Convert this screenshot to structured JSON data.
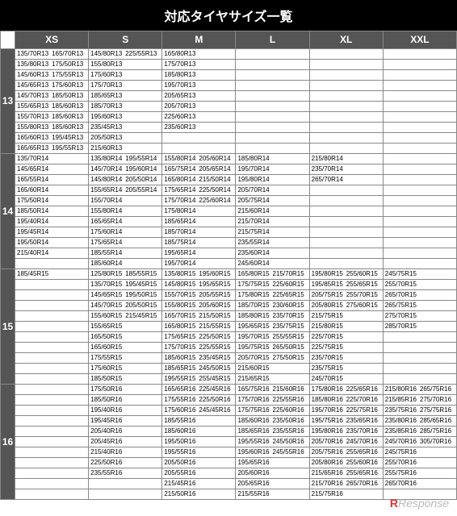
{
  "title": "対応タイヤサイズ一覧",
  "watermark": "Response",
  "sizes": [
    "XS",
    "S",
    "M",
    "L",
    "XL",
    "XXL"
  ],
  "groups": [
    {
      "inch": "13",
      "rows": [
        {
          "XS": [
            "135/70R13",
            "165/70R13"
          ],
          "S": [
            "145/80R13",
            "225/55R13"
          ],
          "M": [
            "165/80R13",
            ""
          ],
          "L": [
            "",
            ""
          ],
          "XL": [
            "",
            ""
          ],
          "XXL": [
            "",
            ""
          ]
        },
        {
          "XS": [
            "135/80R13",
            "175/50R13"
          ],
          "S": [
            "155/80R13",
            ""
          ],
          "M": [
            "175/70R13",
            ""
          ],
          "L": [
            "",
            ""
          ],
          "XL": [
            "",
            ""
          ],
          "XXL": [
            "",
            ""
          ]
        },
        {
          "XS": [
            "145/60R13",
            "175/55R13"
          ],
          "S": [
            "175/60R13",
            ""
          ],
          "M": [
            "185/80R13",
            ""
          ],
          "L": [
            "",
            ""
          ],
          "XL": [
            "",
            ""
          ],
          "XXL": [
            "",
            ""
          ]
        },
        {
          "XS": [
            "145/65R13",
            "175/60R13"
          ],
          "S": [
            "175/70R13",
            ""
          ],
          "M": [
            "195/70R13",
            ""
          ],
          "L": [
            "",
            ""
          ],
          "XL": [
            "",
            ""
          ],
          "XXL": [
            "",
            ""
          ]
        },
        {
          "XS": [
            "145/70R13",
            "185/50R13"
          ],
          "S": [
            "185/65R13",
            ""
          ],
          "M": [
            "205/65R13",
            ""
          ],
          "L": [
            "",
            ""
          ],
          "XL": [
            "",
            ""
          ],
          "XXL": [
            "",
            ""
          ]
        },
        {
          "XS": [
            "155/65R13",
            "185/60R13"
          ],
          "S": [
            "185/70R13",
            ""
          ],
          "M": [
            "205/70R13",
            ""
          ],
          "L": [
            "",
            ""
          ],
          "XL": [
            "",
            ""
          ],
          "XXL": [
            "",
            ""
          ]
        },
        {
          "XS": [
            "155/70R13",
            "185/60R13"
          ],
          "S": [
            "195/60R13",
            ""
          ],
          "M": [
            "225/60R13",
            ""
          ],
          "L": [
            "",
            ""
          ],
          "XL": [
            "",
            ""
          ],
          "XXL": [
            "",
            ""
          ]
        },
        {
          "XS": [
            "155/80R13",
            "185/60R13"
          ],
          "S": [
            "235/45R13",
            ""
          ],
          "M": [
            "235/60R13",
            ""
          ],
          "L": [
            "",
            ""
          ],
          "XL": [
            "",
            ""
          ],
          "XXL": [
            "",
            ""
          ]
        },
        {
          "XS": [
            "165/60R13",
            "195/45R13"
          ],
          "S": [
            "205/50R13",
            ""
          ],
          "M": [
            "",
            ""
          ],
          "L": [
            "",
            ""
          ],
          "XL": [
            "",
            ""
          ],
          "XXL": [
            "",
            ""
          ]
        },
        {
          "XS": [
            "165/65R13",
            "195/55R13"
          ],
          "S": [
            "215/60R13",
            ""
          ],
          "M": [
            "",
            ""
          ],
          "L": [
            "",
            ""
          ],
          "XL": [
            "",
            ""
          ],
          "XXL": [
            "",
            ""
          ]
        }
      ]
    },
    {
      "inch": "14",
      "rows": [
        {
          "XS": [
            "135/70R14",
            ""
          ],
          "S": [
            "135/80R14",
            "195/55R14"
          ],
          "M": [
            "155/80R14",
            "205/60R14"
          ],
          "L": [
            "185/80R14",
            ""
          ],
          "XL": [
            "215/80R14",
            ""
          ],
          "XXL": [
            "",
            ""
          ]
        },
        {
          "XS": [
            "145/65R14",
            ""
          ],
          "S": [
            "145/70R14",
            "195/60R14"
          ],
          "M": [
            "165/75R14",
            "205/65R14"
          ],
          "L": [
            "195/70R14",
            ""
          ],
          "XL": [
            "235/70R14",
            ""
          ],
          "XXL": [
            "",
            ""
          ]
        },
        {
          "XS": [
            "165/55R14",
            ""
          ],
          "S": [
            "145/80R14",
            "205/50R14"
          ],
          "M": [
            "165/80R14",
            "215/50R14"
          ],
          "L": [
            "195/80R14",
            ""
          ],
          "XL": [
            "265/70R14",
            ""
          ],
          "XXL": [
            "",
            ""
          ]
        },
        {
          "XS": [
            "165/60R14",
            ""
          ],
          "S": [
            "155/65R14",
            "205/55R14"
          ],
          "M": [
            "175/65R14",
            "225/50R14"
          ],
          "L": [
            "205/70R14",
            ""
          ],
          "XL": [
            "",
            ""
          ],
          "XXL": [
            "",
            ""
          ]
        },
        {
          "XS": [
            "175/50R14",
            ""
          ],
          "S": [
            "155/70R14",
            ""
          ],
          "M": [
            "175/70R14",
            "225/60R14"
          ],
          "L": [
            "205/75R14",
            ""
          ],
          "XL": [
            "",
            ""
          ],
          "XXL": [
            "",
            ""
          ]
        },
        {
          "XS": [
            "185/50R14",
            ""
          ],
          "S": [
            "155/80R14",
            ""
          ],
          "M": [
            "175/80R14",
            ""
          ],
          "L": [
            "215/60R14",
            ""
          ],
          "XXL": [
            "",
            ""
          ],
          "XL": [
            "",
            ""
          ]
        },
        {
          "XS": [
            "195/40R14",
            ""
          ],
          "S": [
            "165/65R14",
            ""
          ],
          "M": [
            "185/65R14",
            ""
          ],
          "L": [
            "215/70R14",
            ""
          ],
          "XL": [
            "",
            ""
          ],
          "XXL": [
            "",
            ""
          ]
        },
        {
          "XS": [
            "195/45R14",
            ""
          ],
          "S": [
            "175/60R14",
            ""
          ],
          "M": [
            "185/70R14",
            ""
          ],
          "L": [
            "215/75R14",
            ""
          ],
          "XL": [
            "",
            ""
          ],
          "XXL": [
            "",
            ""
          ]
        },
        {
          "XS": [
            "195/50R14",
            ""
          ],
          "S": [
            "175/65R14",
            ""
          ],
          "M": [
            "185/75R14",
            ""
          ],
          "L": [
            "235/55R14",
            ""
          ],
          "XL": [
            "",
            ""
          ],
          "XXL": [
            "",
            ""
          ]
        },
        {
          "XS": [
            "215/40R14",
            ""
          ],
          "S": [
            "185/55R14",
            ""
          ],
          "M": [
            "195/65R14",
            ""
          ],
          "L": [
            "235/60R14",
            ""
          ],
          "XL": [
            "",
            ""
          ],
          "XXL": [
            "",
            ""
          ]
        },
        {
          "XS": [
            "",
            ""
          ],
          "S": [
            "185/60R14",
            ""
          ],
          "M": [
            "195/70R14",
            ""
          ],
          "L": [
            "245/60R14",
            ""
          ],
          "XL": [
            "",
            ""
          ],
          "XXL": [
            "",
            ""
          ]
        }
      ]
    },
    {
      "inch": "15",
      "rows": [
        {
          "XS": [
            "185/45R15",
            ""
          ],
          "S": [
            "125/80R15",
            "185/55R15"
          ],
          "M": [
            "135/80R15",
            "195/60R15"
          ],
          "L": [
            "165/80R15",
            "215/70R15"
          ],
          "XL": [
            "195/80R15",
            "255/60R15"
          ],
          "XXL": [
            "245/75R15",
            ""
          ]
        },
        {
          "XS": [
            "",
            ""
          ],
          "S": [
            "135/70R15",
            "195/45R15"
          ],
          "M": [
            "145/80R15",
            "195/65R15"
          ],
          "L": [
            "175/75R15",
            "225/60R15"
          ],
          "XL": [
            "195/85R15",
            "255/65R15"
          ],
          "XXL": [
            "255/70R15",
            ""
          ]
        },
        {
          "XS": [
            "",
            ""
          ],
          "S": [
            "145/65R15",
            "195/50R15"
          ],
          "M": [
            "155/70R15",
            "205/55R15"
          ],
          "L": [
            "175/80R15",
            "225/65R15"
          ],
          "XL": [
            "205/75R15",
            "255/70R15"
          ],
          "XXL": [
            "265/70R15",
            ""
          ]
        },
        {
          "XS": [
            "",
            ""
          ],
          "S": [
            "145/70R15",
            "205/50R15"
          ],
          "M": [
            "155/80R15",
            "205/60R15"
          ],
          "L": [
            "185/70R15",
            "230/60R15"
          ],
          "XL": [
            "205/80R15",
            "275/60R15"
          ],
          "XXL": [
            "265/75R15",
            ""
          ]
        },
        {
          "XS": [
            "",
            ""
          ],
          "S": [
            "155/60R15",
            "215/45R15"
          ],
          "M": [
            "165/70R15",
            "215/50R15"
          ],
          "L": [
            "185/80R15",
            "235/70R15"
          ],
          "XL": [
            "215/75R15",
            ""
          ],
          "XXL": [
            "275/70R15",
            ""
          ]
        },
        {
          "XS": [
            "",
            ""
          ],
          "S": [
            "155/65R15",
            ""
          ],
          "M": [
            "165/80R15",
            "215/55R15"
          ],
          "L": [
            "195/65R15",
            "235/75R15"
          ],
          "XL": [
            "215/80R15",
            ""
          ],
          "XXL": [
            "285/70R15",
            ""
          ]
        },
        {
          "XS": [
            "",
            ""
          ],
          "S": [
            "165/50R15",
            ""
          ],
          "M": [
            "175/65R15",
            "225/50R15"
          ],
          "L": [
            "195/70R15",
            "255/55R15"
          ],
          "XL": [
            "225/70R15",
            ""
          ],
          "XXL": [
            "",
            ""
          ]
        },
        {
          "XS": [
            "",
            ""
          ],
          "S": [
            "165/60R15",
            ""
          ],
          "M": [
            "175/70R15",
            "225/55R15"
          ],
          "L": [
            "195/75R15",
            "265/50R15"
          ],
          "XL": [
            "225/75R15",
            ""
          ],
          "XXL": [
            "",
            ""
          ]
        },
        {
          "XS": [
            "",
            ""
          ],
          "S": [
            "175/55R15",
            ""
          ],
          "M": [
            "185/60R15",
            "235/45R15"
          ],
          "L": [
            "205/70R15",
            "275/50R15"
          ],
          "XL": [
            "235/70R15",
            ""
          ],
          "XXL": [
            "",
            ""
          ]
        },
        {
          "XS": [
            "",
            ""
          ],
          "S": [
            "175/60R15",
            ""
          ],
          "M": [
            "185/65R15",
            "245/50R15"
          ],
          "L": [
            "215/60R15",
            ""
          ],
          "XL": [
            "235/75R15",
            ""
          ],
          "XXL": [
            "",
            ""
          ]
        },
        {
          "XS": [
            "",
            ""
          ],
          "S": [
            "185/50R15",
            ""
          ],
          "M": [
            "195/55R15",
            "255/45R15"
          ],
          "L": [
            "215/65R15",
            ""
          ],
          "XL": [
            "245/70R15",
            ""
          ],
          "XXL": [
            "",
            ""
          ]
        }
      ]
    },
    {
      "inch": "16",
      "rows": [
        {
          "XS": [
            "",
            ""
          ],
          "S": [
            "175/50R16",
            ""
          ],
          "M": [
            "165/65R16",
            "225/45R16"
          ],
          "L": [
            "165/75R16",
            "215/60R16"
          ],
          "XL": [
            "175/80R16",
            "225/65R16"
          ],
          "XXL": [
            "215/80R16",
            "265/75R16"
          ]
        },
        {
          "XS": [
            "",
            ""
          ],
          "S": [
            "185/50R16",
            ""
          ],
          "M": [
            "175/55R16",
            "225/50R16"
          ],
          "L": [
            "175/70R16",
            "225/55R16"
          ],
          "XL": [
            "185/80R16",
            "225/70R16"
          ],
          "XXL": [
            "215/85R16",
            "275/70R16"
          ]
        },
        {
          "XS": [
            "",
            ""
          ],
          "S": [
            "195/40R16",
            ""
          ],
          "M": [
            "175/60R16",
            "245/45R16"
          ],
          "L": [
            "175/75R16",
            "225/60R16"
          ],
          "XL": [
            "195/70R16",
            "225/75R16"
          ],
          "XXL": [
            "235/75R16",
            "275/75R16"
          ]
        },
        {
          "XS": [
            "",
            ""
          ],
          "S": [
            "195/45R16",
            ""
          ],
          "M": [
            "185/55R16",
            ""
          ],
          "M2": "",
          "L": [
            "185/60R16",
            "235/50R16"
          ],
          "XL": [
            "195/75R16",
            "235/65R16"
          ],
          "XXL": [
            "235/80R16",
            "285/65R16"
          ]
        },
        {
          "XS": [
            "",
            ""
          ],
          "S": [
            "205/40R16",
            ""
          ],
          "M": [
            "185/60R16",
            ""
          ],
          "L": [
            "185/65R16",
            "235/55R16"
          ],
          "XL": [
            "195/80R16",
            "235/70R16"
          ],
          "XXL": [
            "235/85R16",
            "285/75R16"
          ]
        },
        {
          "XS": [
            "",
            ""
          ],
          "S": [
            "205/45R16",
            ""
          ],
          "M": [
            "195/50R16",
            ""
          ],
          "L": [
            "195/55R16",
            "245/50R16"
          ],
          "XL": [
            "205/70R16",
            "245/70R16"
          ],
          "XXL": [
            "245/70R16",
            "305/70R16"
          ]
        },
        {
          "XS": [
            "",
            ""
          ],
          "S": [
            "215/40R16",
            ""
          ],
          "M": [
            "195/55R16",
            ""
          ],
          "L": [
            "195/60R16",
            "245/55R16"
          ],
          "XL": [
            "205/75R16",
            "255/65R16"
          ],
          "XXL": [
            "245/75R16",
            ""
          ]
        },
        {
          "XS": [
            "",
            ""
          ],
          "S": [
            "225/50R16",
            ""
          ],
          "M": [
            "205/50R16",
            ""
          ],
          "L": [
            "195/65R16",
            ""
          ],
          "XL": [
            "205/80R16",
            "255/60R16"
          ],
          "XXL": [
            "255/70R16",
            ""
          ]
        },
        {
          "XS": [
            "",
            ""
          ],
          "S": [
            "235/55R16",
            ""
          ],
          "M": [
            "205/55R16",
            ""
          ],
          "L": [
            "205/60R16",
            ""
          ],
          "XL": [
            "215/65R16",
            "255/65R16"
          ],
          "XXL": [
            "255/75R16",
            ""
          ]
        },
        {
          "XS": [
            "",
            ""
          ],
          "S": [
            "",
            ""
          ],
          "M": [
            "215/45R16",
            ""
          ],
          "L": [
            "205/65R16",
            ""
          ],
          "XL": [
            "215/70R16",
            "265/70R16"
          ],
          "XXL": [
            "265/70R16",
            ""
          ]
        },
        {
          "XS": [
            "",
            ""
          ],
          "S": [
            "",
            ""
          ],
          "M": [
            "215/50R16",
            ""
          ],
          "L": [
            "215/55R16",
            ""
          ],
          "XL": [
            "215/75R16",
            ""
          ],
          "XXL": [
            "",
            ""
          ]
        }
      ]
    }
  ]
}
